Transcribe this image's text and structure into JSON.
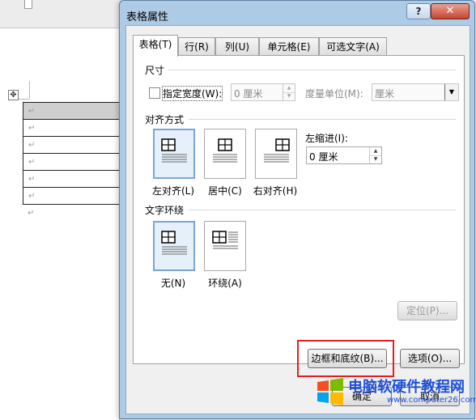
{
  "document": {
    "table_rows": 6,
    "paragraph_mark": "↵",
    "anchor_glyph": "✥"
  },
  "dialog": {
    "title": "表格属性",
    "help_label": "?",
    "close_label": "✕",
    "tabs": [
      {
        "label": "表格(T)",
        "active": true
      },
      {
        "label": "行(R)",
        "active": false
      },
      {
        "label": "列(U)",
        "active": false
      },
      {
        "label": "单元格(E)",
        "active": false
      },
      {
        "label": "可选文字(A)",
        "active": false
      }
    ],
    "size_section": {
      "title": "尺寸",
      "preferred_width_label": "指定宽度(W):",
      "preferred_width_checked": false,
      "width_value": "0 厘米",
      "measure_label": "度量单位(M):",
      "measure_value": "厘米"
    },
    "alignment_section": {
      "title": "对齐方式",
      "options": [
        {
          "label": "左对齐(L)",
          "selected": true
        },
        {
          "label": "居中(C)",
          "selected": false
        },
        {
          "label": "右对齐(H)",
          "selected": false
        }
      ],
      "indent_label": "左缩进(I):",
      "indent_value": "0 厘米"
    },
    "wrapping_section": {
      "title": "文字环绕",
      "options": [
        {
          "label": "无(N)",
          "selected": true
        },
        {
          "label": "环绕(A)",
          "selected": false
        }
      ],
      "position_button": "定位(P)..."
    },
    "buttons": {
      "borders_shading": "边框和底纹(B)...",
      "options": "选项(O)...",
      "ok": "确定",
      "cancel": "取消"
    }
  },
  "watermark": {
    "text": "电脑软硬件教程网",
    "url": "www.computer26.com"
  },
  "colors": {
    "dialog_frame": "#aecbe6",
    "highlight": "#e02020",
    "selected_option": "#7aa6d6",
    "watermark_text": "#1d4fd8"
  }
}
